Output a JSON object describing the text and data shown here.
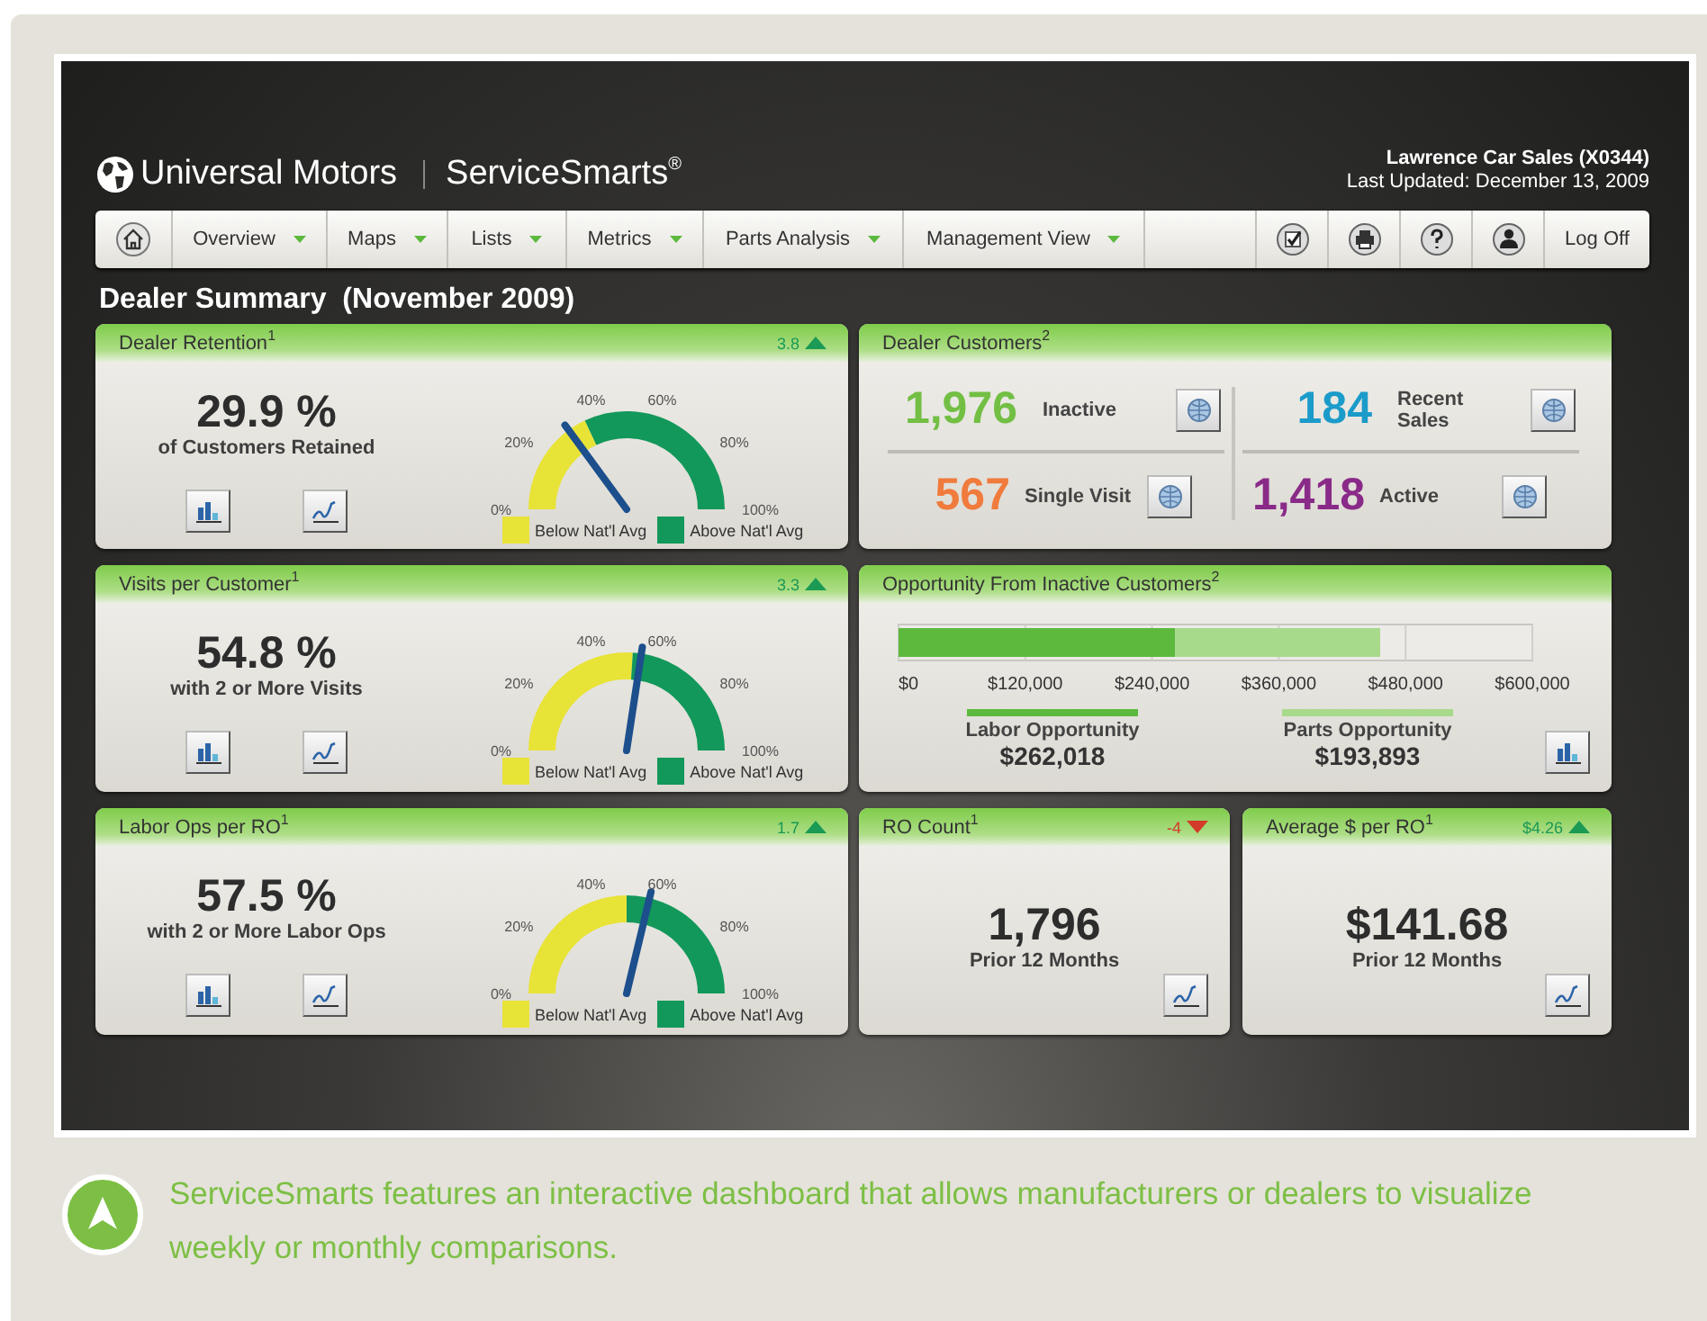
{
  "brand": {
    "company": "Universal Motors",
    "product": "ServiceSmarts$^{®}$"
  },
  "account": {
    "dealer": "Lawrence Car Sales (X0344)",
    "updated": "Last Updated: December 13, 2009"
  },
  "nav": {
    "menus": [
      {
        "label": "Overview",
        "has_menu": true
      },
      {
        "label": "Maps",
        "has_menu": true
      },
      {
        "label": "Lists",
        "has_menu": true
      },
      {
        "label": "Metrics",
        "has_menu": true
      },
      {
        "label": "Parts Analysis",
        "has_menu": true
      },
      {
        "label": "Management View",
        "has_menu": true
      }
    ],
    "logoff": "Log Off"
  },
  "page_title": "Dealer Summary  (November 2009)",
  "gauges": [
    {
      "title": "Dealer Retention",
      "note": "1",
      "change": "3.8",
      "rising": true,
      "value": "29.9 %",
      "caption": "of Customers Retained",
      "ticks": [
        "0%",
        "20%",
        "40%",
        "60%",
        "80%",
        "100%"
      ],
      "legend": [
        {
          "label": "Below Nat'l Avg",
          "color": "#e8e337"
        },
        {
          "label": "Above Nat'l Avg",
          "color": "#12985a"
        }
      ]
    },
    {
      "title": "Visits per Customer",
      "note": "1",
      "change": "3.3",
      "rising": true,
      "value": "54.8 %",
      "caption": "with 2 or More Visits",
      "ticks": [
        "0%",
        "20%",
        "40%",
        "60%",
        "80%",
        "100%"
      ],
      "legend": [
        {
          "label": "Below Nat'l Avg",
          "color": "#e8e337"
        },
        {
          "label": "Above Nat'l Avg",
          "color": "#12985a"
        }
      ]
    },
    {
      "title": "Labor Ops per RO",
      "note": "1",
      "change": "1.7",
      "rising": true,
      "value": "57.5 %",
      "caption": "with 2 or More Labor Ops",
      "ticks": [
        "0%",
        "20%",
        "40%",
        "60%",
        "80%",
        "100%"
      ],
      "legend": [
        {
          "label": "Below Nat'l Avg",
          "color": "#e8e337"
        },
        {
          "label": "Above Nat'l Avg",
          "color": "#12985a"
        }
      ]
    }
  ],
  "customers": {
    "title": "Dealer Customers",
    "note": "2",
    "stats": [
      {
        "value": "1,976",
        "label": "Inactive",
        "color": "#72bf44"
      },
      {
        "value": "184",
        "label": "Recent Sales",
        "color": "#1b9bc9"
      },
      {
        "value": "567",
        "label": "Single Visit",
        "color": "#f07b3c"
      },
      {
        "value": "1,418",
        "label": "Active",
        "color": "#8a2a88"
      }
    ]
  },
  "opportunity": {
    "title": "Opportunity From Inactive Customers",
    "note": "2",
    "chart_data": {
      "type": "bar",
      "orientation": "horizontal",
      "stacked": true,
      "grid": true,
      "series": [
        {
          "name": "Labor Opportunity",
          "color": "#5cb93e",
          "values": [
            262000
          ]
        },
        {
          "name": "Parts Opportunity",
          "color": "#a8da8c",
          "values": [
            194000
          ]
        }
      ],
      "xlim": [
        0,
        600000
      ],
      "xticks": [
        {
          "value": 0,
          "label": "$0"
        },
        {
          "value": 120000,
          "label": "$120,000"
        },
        {
          "value": 240000,
          "label": "$240,000"
        },
        {
          "value": 360000,
          "label": "$360,000"
        },
        {
          "value": 480000,
          "label": "$480,000"
        },
        {
          "value": 600000,
          "label": "$600,000"
        }
      ]
    },
    "totals": [
      "$262,018",
      "$193,893"
    ]
  },
  "summaries": [
    {
      "title": "RO Count",
      "note": "1",
      "change": "-4",
      "rising": false,
      "value": "1,796",
      "caption": "Prior 12 Months"
    },
    {
      "title": "Average $ per RO",
      "note": "1",
      "change": "$4.26",
      "rising": true,
      "value": "$141.68",
      "caption": "Prior 12 Months"
    }
  ],
  "caption": "ServiceSmarts features an interactive dashboard that allows manufacturers or dealers to visualize weekly or monthly comparisons."
}
